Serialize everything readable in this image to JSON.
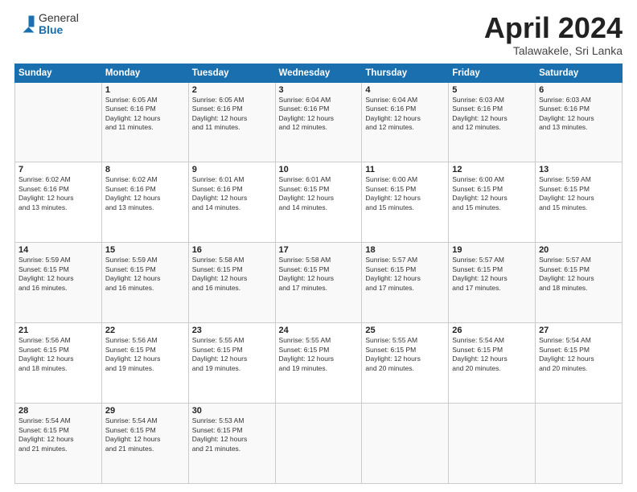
{
  "header": {
    "logo_general": "General",
    "logo_blue": "Blue",
    "month_title": "April 2024",
    "subtitle": "Talawakele, Sri Lanka"
  },
  "weekdays": [
    "Sunday",
    "Monday",
    "Tuesday",
    "Wednesday",
    "Thursday",
    "Friday",
    "Saturday"
  ],
  "weeks": [
    [
      {
        "day": "",
        "info": ""
      },
      {
        "day": "1",
        "info": "Sunrise: 6:05 AM\nSunset: 6:16 PM\nDaylight: 12 hours\nand 11 minutes."
      },
      {
        "day": "2",
        "info": "Sunrise: 6:05 AM\nSunset: 6:16 PM\nDaylight: 12 hours\nand 11 minutes."
      },
      {
        "day": "3",
        "info": "Sunrise: 6:04 AM\nSunset: 6:16 PM\nDaylight: 12 hours\nand 12 minutes."
      },
      {
        "day": "4",
        "info": "Sunrise: 6:04 AM\nSunset: 6:16 PM\nDaylight: 12 hours\nand 12 minutes."
      },
      {
        "day": "5",
        "info": "Sunrise: 6:03 AM\nSunset: 6:16 PM\nDaylight: 12 hours\nand 12 minutes."
      },
      {
        "day": "6",
        "info": "Sunrise: 6:03 AM\nSunset: 6:16 PM\nDaylight: 12 hours\nand 13 minutes."
      }
    ],
    [
      {
        "day": "7",
        "info": "Sunrise: 6:02 AM\nSunset: 6:16 PM\nDaylight: 12 hours\nand 13 minutes."
      },
      {
        "day": "8",
        "info": "Sunrise: 6:02 AM\nSunset: 6:16 PM\nDaylight: 12 hours\nand 13 minutes."
      },
      {
        "day": "9",
        "info": "Sunrise: 6:01 AM\nSunset: 6:16 PM\nDaylight: 12 hours\nand 14 minutes."
      },
      {
        "day": "10",
        "info": "Sunrise: 6:01 AM\nSunset: 6:15 PM\nDaylight: 12 hours\nand 14 minutes."
      },
      {
        "day": "11",
        "info": "Sunrise: 6:00 AM\nSunset: 6:15 PM\nDaylight: 12 hours\nand 15 minutes."
      },
      {
        "day": "12",
        "info": "Sunrise: 6:00 AM\nSunset: 6:15 PM\nDaylight: 12 hours\nand 15 minutes."
      },
      {
        "day": "13",
        "info": "Sunrise: 5:59 AM\nSunset: 6:15 PM\nDaylight: 12 hours\nand 15 minutes."
      }
    ],
    [
      {
        "day": "14",
        "info": "Sunrise: 5:59 AM\nSunset: 6:15 PM\nDaylight: 12 hours\nand 16 minutes."
      },
      {
        "day": "15",
        "info": "Sunrise: 5:59 AM\nSunset: 6:15 PM\nDaylight: 12 hours\nand 16 minutes."
      },
      {
        "day": "16",
        "info": "Sunrise: 5:58 AM\nSunset: 6:15 PM\nDaylight: 12 hours\nand 16 minutes."
      },
      {
        "day": "17",
        "info": "Sunrise: 5:58 AM\nSunset: 6:15 PM\nDaylight: 12 hours\nand 17 minutes."
      },
      {
        "day": "18",
        "info": "Sunrise: 5:57 AM\nSunset: 6:15 PM\nDaylight: 12 hours\nand 17 minutes."
      },
      {
        "day": "19",
        "info": "Sunrise: 5:57 AM\nSunset: 6:15 PM\nDaylight: 12 hours\nand 17 minutes."
      },
      {
        "day": "20",
        "info": "Sunrise: 5:57 AM\nSunset: 6:15 PM\nDaylight: 12 hours\nand 18 minutes."
      }
    ],
    [
      {
        "day": "21",
        "info": "Sunrise: 5:56 AM\nSunset: 6:15 PM\nDaylight: 12 hours\nand 18 minutes."
      },
      {
        "day": "22",
        "info": "Sunrise: 5:56 AM\nSunset: 6:15 PM\nDaylight: 12 hours\nand 19 minutes."
      },
      {
        "day": "23",
        "info": "Sunrise: 5:55 AM\nSunset: 6:15 PM\nDaylight: 12 hours\nand 19 minutes."
      },
      {
        "day": "24",
        "info": "Sunrise: 5:55 AM\nSunset: 6:15 PM\nDaylight: 12 hours\nand 19 minutes."
      },
      {
        "day": "25",
        "info": "Sunrise: 5:55 AM\nSunset: 6:15 PM\nDaylight: 12 hours\nand 20 minutes."
      },
      {
        "day": "26",
        "info": "Sunrise: 5:54 AM\nSunset: 6:15 PM\nDaylight: 12 hours\nand 20 minutes."
      },
      {
        "day": "27",
        "info": "Sunrise: 5:54 AM\nSunset: 6:15 PM\nDaylight: 12 hours\nand 20 minutes."
      }
    ],
    [
      {
        "day": "28",
        "info": "Sunrise: 5:54 AM\nSunset: 6:15 PM\nDaylight: 12 hours\nand 21 minutes."
      },
      {
        "day": "29",
        "info": "Sunrise: 5:54 AM\nSunset: 6:15 PM\nDaylight: 12 hours\nand 21 minutes."
      },
      {
        "day": "30",
        "info": "Sunrise: 5:53 AM\nSunset: 6:15 PM\nDaylight: 12 hours\nand 21 minutes."
      },
      {
        "day": "",
        "info": ""
      },
      {
        "day": "",
        "info": ""
      },
      {
        "day": "",
        "info": ""
      },
      {
        "day": "",
        "info": ""
      }
    ]
  ]
}
